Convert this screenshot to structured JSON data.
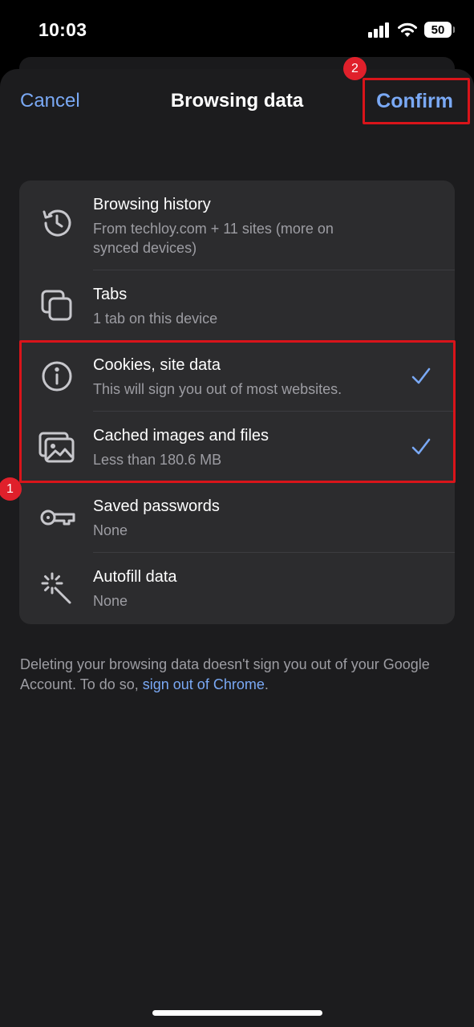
{
  "status_bar": {
    "time": "10:03",
    "battery": "50",
    "icons": [
      "cellular-signal-icon",
      "wifi-icon",
      "battery-icon"
    ]
  },
  "nav": {
    "cancel_label": "Cancel",
    "title": "Browsing data",
    "confirm_label": "Confirm"
  },
  "items": [
    {
      "title": "Browsing history",
      "subtitle": "From techloy.com + 11 sites (more on synced devices)",
      "icon": "history-icon",
      "checked": false
    },
    {
      "title": "Tabs",
      "subtitle": "1 tab on this device",
      "icon": "tabs-icon",
      "checked": false
    },
    {
      "title": "Cookies, site data",
      "subtitle": "This will sign you out of most websites.",
      "icon": "info-icon",
      "checked": true
    },
    {
      "title": "Cached images and files",
      "subtitle": "Less than 180.6 MB",
      "icon": "images-icon",
      "checked": true
    },
    {
      "title": "Saved passwords",
      "subtitle": "None",
      "icon": "key-icon",
      "checked": false
    },
    {
      "title": "Autofill data",
      "subtitle": "None",
      "icon": "magic-wand-icon",
      "checked": false
    }
  ],
  "footer": {
    "text_before": "Deleting your browsing data doesn't sign you out of your Google Account. To do so, ",
    "link_text": "sign out of Chrome",
    "text_after": "."
  },
  "annotations": {
    "marker_1": "1",
    "marker_2": "2"
  },
  "colors": {
    "accent": "#7aa9f5",
    "highlight": "#d9141a",
    "marker": "#e0202b"
  }
}
